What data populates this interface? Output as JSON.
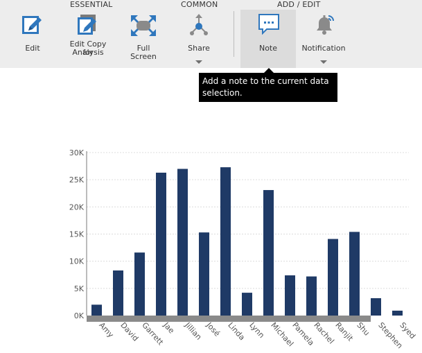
{
  "toolbar": {
    "groups": {
      "essential": "ESSENTIAL",
      "common": "COMMON",
      "add_edit": "ADD / EDIT"
    },
    "buttons": {
      "edit": "Edit",
      "edit_copy_line1": "Edit Copy for",
      "edit_copy_line2": "Analysis",
      "full_screen": "Full Screen",
      "share": "Share",
      "note": "Note",
      "notification": "Notification"
    },
    "icon_color": "#2f77bd"
  },
  "tooltip": {
    "text": "Add a note to the current data selection."
  },
  "chart_data": {
    "type": "bar",
    "categories": [
      "Amy",
      "David",
      "Garrett",
      "Jae",
      "Jillian",
      "José",
      "Linda",
      "Lynn",
      "Michael",
      "Pamela",
      "Rachel",
      "Ranjit",
      "Shu",
      "Stephen",
      "Syed"
    ],
    "values": [
      2000,
      8300,
      11600,
      26300,
      27000,
      15300,
      27300,
      4200,
      23100,
      7400,
      7200,
      14100,
      15400,
      3200,
      900
    ],
    "ytick_labels": [
      "0K",
      "5K",
      "10K",
      "15K",
      "20K",
      "25K",
      "30K"
    ],
    "ylim": [
      0,
      30000
    ],
    "ytick_step": 5000,
    "bar_color": "#1f3a66",
    "selection_band_color": "#8a8a8a",
    "grid": true
  }
}
